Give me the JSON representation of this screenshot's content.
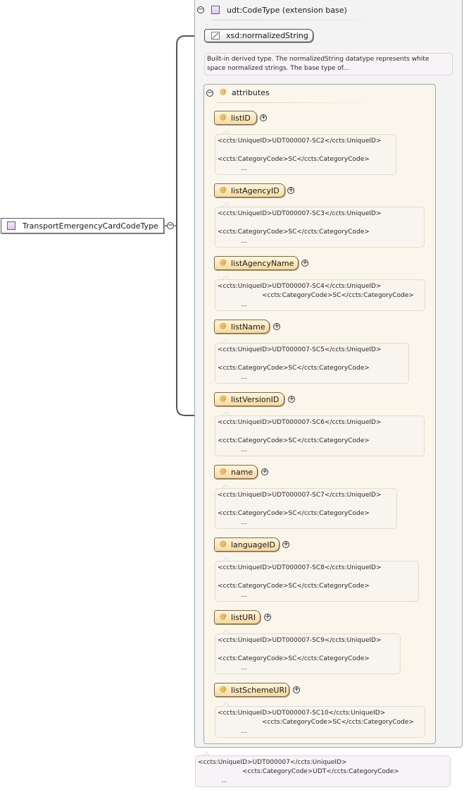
{
  "root_type": {
    "name": "TransportEmergencyCardCodeType",
    "icon": "complex-type-icon"
  },
  "extension": {
    "label": "udt:CodeType (extension base)",
    "icon": "complex-type-icon"
  },
  "base_type": {
    "name": "xsd:normalizedString",
    "icon": "simple-type-icon",
    "doc_line1": "Built-in derived type. The normalizedString datatype represents white",
    "doc_line2": "space normalized strings. The base type of..."
  },
  "attributes_group": {
    "label": "attributes",
    "symbol": "@"
  },
  "attributes": [
    {
      "name": "listID",
      "line1": "<ccts:UniqueID>UDT000007-SC2</ccts:UniqueID>",
      "line2": "<ccts:CategoryCode>SC</ccts:CategoryCode>",
      "line3": "..."
    },
    {
      "name": "listAgencyID",
      "line1": "<ccts:UniqueID>UDT000007-SC3</ccts:UniqueID>",
      "line2": "<ccts:CategoryCode>SC</ccts:CategoryCode>",
      "line3": "..."
    },
    {
      "name": "listAgencyName",
      "line1": "<ccts:UniqueID>UDT000007-SC4</ccts:UniqueID>",
      "line2": "<ccts:CategoryCode>SC</ccts:CategoryCode>",
      "line3": "..."
    },
    {
      "name": "listName",
      "line1": "<ccts:UniqueID>UDT000007-SC5</ccts:UniqueID>",
      "line2": "<ccts:CategoryCode>SC</ccts:CategoryCode>",
      "line3": "..."
    },
    {
      "name": "listVersionID",
      "line1": "<ccts:UniqueID>UDT000007-SC6</ccts:UniqueID>",
      "line2": "<ccts:CategoryCode>SC</ccts:CategoryCode>",
      "line3": "..."
    },
    {
      "name": "name",
      "line1": "<ccts:UniqueID>UDT000007-SC7</ccts:UniqueID>",
      "line2": "<ccts:CategoryCode>SC</ccts:CategoryCode>",
      "line3": "..."
    },
    {
      "name": "languageID",
      "line1": "<ccts:UniqueID>UDT000007-SC8</ccts:UniqueID>",
      "line2": "<ccts:CategoryCode>SC</ccts:CategoryCode>",
      "line3": "..."
    },
    {
      "name": "listURI",
      "line1": "<ccts:UniqueID>UDT000007-SC9</ccts:UniqueID>",
      "line2": "<ccts:CategoryCode>SC</ccts:CategoryCode>",
      "line3": "..."
    },
    {
      "name": "listSchemeURI",
      "line1": "<ccts:UniqueID>UDT000007-SC10</ccts:UniqueID>",
      "line2": "<ccts:CategoryCode>SC</ccts:CategoryCode>",
      "line3": "..."
    }
  ],
  "type_annotation": {
    "line1": "<ccts:UniqueID>UDT000007</ccts:UniqueID>",
    "line2": "<ccts:CategoryCode>UDT</ccts:CategoryCode>",
    "line3": "..."
  },
  "symbols": {
    "collapse": "−",
    "expand": "+"
  }
}
